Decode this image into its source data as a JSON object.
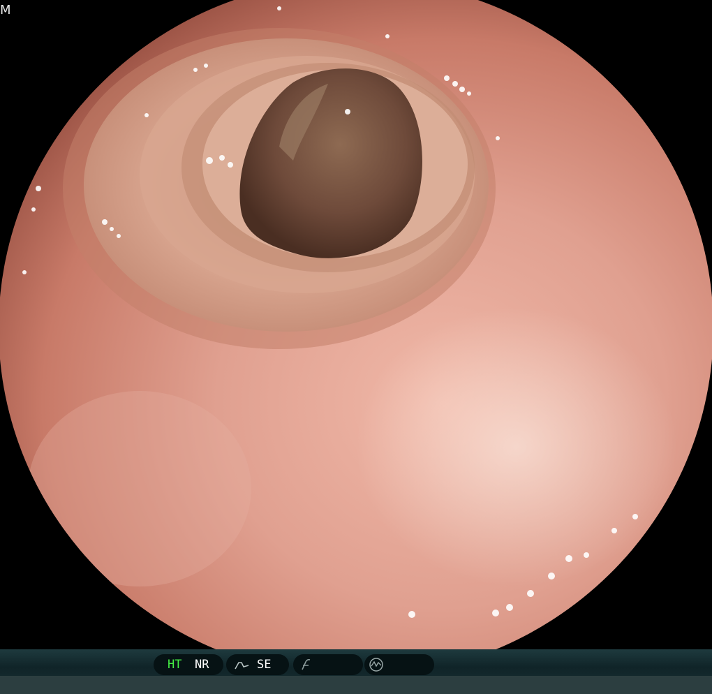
{
  "corner_label": "M",
  "status_bar": {
    "ht_label": "HT",
    "nr_label": "NR",
    "se_label": "SE",
    "icons": [
      "enhancement-curve-icon",
      "sharpness-icon",
      "waveform-icon"
    ]
  },
  "colors": {
    "ht_active": "#44ee44",
    "mucosa": "#d99080",
    "lumen": "#6e4a3a"
  }
}
